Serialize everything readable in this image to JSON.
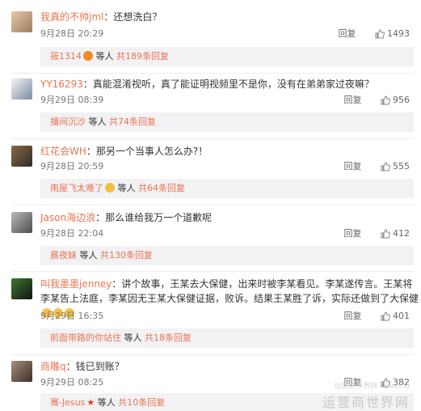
{
  "comments": [
    {
      "user": "我真的不帅jml",
      "text": "：还想洗白？",
      "date": "9月28日 20:29",
      "reply_label": "回复",
      "likes": "1493",
      "sub_user": "莜1314",
      "sub_etc": "等人",
      "sub_count": "共189条回复",
      "sub_icon": "fox-emoji"
    },
    {
      "user": "YY16293",
      "text": "：真能混淆视听，真了能证明视频里不是你，没有在弟弟家过夜嘛？",
      "date": "9月29日 08:39",
      "reply_label": "回复",
      "likes": "956",
      "sub_user": "播间沉沙",
      "sub_etc": "等人",
      "sub_count": "共74条回复"
    },
    {
      "user": "红花会WH",
      "text": "：那另一个当事人怎么办?！",
      "date": "9月28日 20:59",
      "reply_label": "回复",
      "likes": "555",
      "sub_user": "南屋飞太难了",
      "sub_etc": "等人",
      "sub_count": "共64条回复",
      "sub_icon": "sad-emoji"
    },
    {
      "user": "Jason海边浪",
      "text": "：那么谁给我万一个道歉呢",
      "date": "9月28日 22:04",
      "reply_label": "回复",
      "likes": "412",
      "sub_user": "晨夜妹",
      "sub_etc": "等人",
      "sub_count": "共130条回复"
    },
    {
      "user": "叫我墨墨jenney",
      "text": "：讲个故事，王某去大保健，出来时被李某看见。李某遂传言。王某将李某告上法庭，李某因无王某大保健证据，败诉。结果王某胜了诉，实际还做到了大保健",
      "date": "9月29日 16:35",
      "reply_label": "回复",
      "likes": "401",
      "sub_user": "前面带路的你站住",
      "sub_etc": "等人",
      "sub_count": "共18条回复",
      "text_emoji": "laugh-emoji"
    },
    {
      "user": "商雕q",
      "text": "：钱已到账？",
      "date": "9月29日 08:25",
      "reply_label": "回复",
      "likes": "382",
      "sub_user": "骞-Jesus",
      "sub_etc": "等人",
      "sub_count": "共10条回复",
      "sub_icon": "star-icon"
    }
  ],
  "watermark": {
    "main": "运营商世界网",
    "small": "运营商世界网 Telworld"
  },
  "colors": {
    "username": "#eb7350",
    "subbar": "#f2f2f5"
  }
}
